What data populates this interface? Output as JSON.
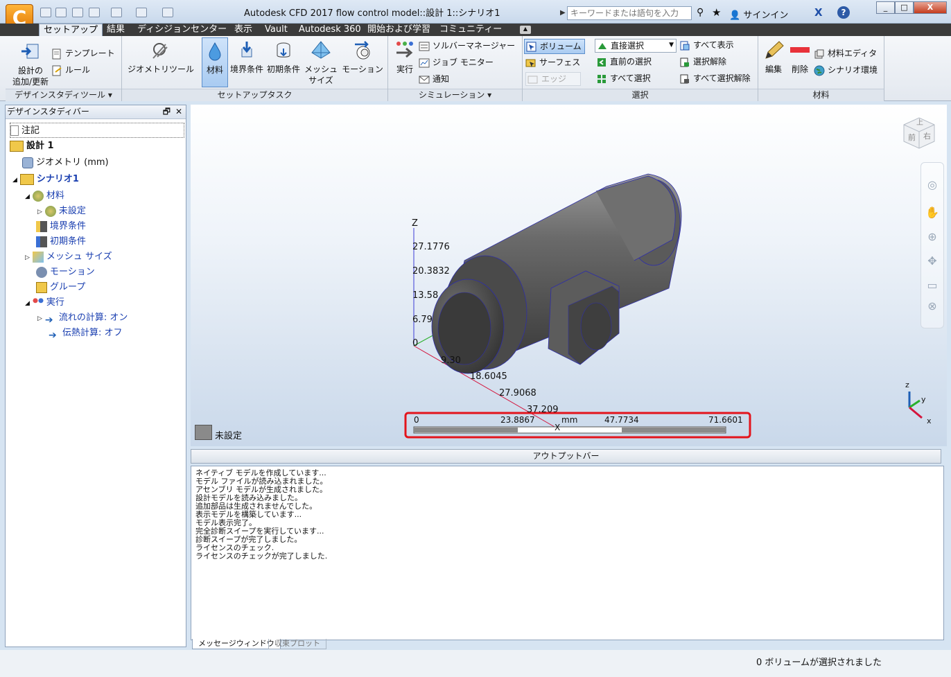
{
  "window": {
    "title": "Autodesk CFD 2017   flow control model::設計  1::シナリオ1",
    "search_placeholder": "キーワードまたは語句を入力",
    "signin": "サインイン",
    "minimize": "_",
    "maximize": "□",
    "close": "X"
  },
  "tabs": [
    "セットアップ",
    "結果",
    "ディシジョンセンター",
    "表示",
    "Vault",
    "Autodesk 360",
    "開始および学習",
    "コミュニティー"
  ],
  "ribbon": {
    "design_tools": {
      "group_label": "デザインスタディツール ▾",
      "add_update": [
        "設計の",
        "追加/更新"
      ],
      "template": "テンプレート",
      "rule": "ルール"
    },
    "setup": {
      "group_label": "セットアップタスク",
      "geometry_tool": "ジオメトリツール",
      "material": "材料",
      "boundary": "境界条件",
      "initial": "初期条件",
      "mesh": [
        "メッシュ",
        "サイズ"
      ],
      "motion": "モーション"
    },
    "simulation": {
      "group_label": "シミュレーション ▾",
      "run": "実行",
      "solver_manager": "ソルバーマネージャー",
      "job_monitor": "ジョブ モニター",
      "notify": "通知"
    },
    "select": {
      "group_label": "選択",
      "volume": "ボリューム",
      "surface": "サーフェス",
      "edge": "エッジ",
      "direct_select": "直接選択",
      "prev_select": "直前の選択",
      "select_all": "すべて選択",
      "show_all": "すべて表示",
      "deselect": "選択解除",
      "deselect_all": "すべて選択解除"
    },
    "material": {
      "group_label": "材料",
      "edit": "編集",
      "delete": "削除",
      "editor": "材料エディタ",
      "scenario_env": "シナリオ環境"
    }
  },
  "design_bar": {
    "title": "デザインスタディバー",
    "items": [
      {
        "label": "注記",
        "level": 0
      },
      {
        "label": "設計  1",
        "level": 0
      },
      {
        "label": "ジオメトリ (mm)",
        "level": 1
      },
      {
        "label": "シナリオ1",
        "level": 1
      },
      {
        "label": "材料",
        "level": 2
      },
      {
        "label": "未設定",
        "level": 3
      },
      {
        "label": "境界条件",
        "level": 2
      },
      {
        "label": "初期条件",
        "level": 2
      },
      {
        "label": "メッシュ サイズ",
        "level": 2
      },
      {
        "label": "モーション",
        "level": 2
      },
      {
        "label": "グループ",
        "level": 2
      },
      {
        "label": "実行",
        "level": 2
      },
      {
        "label": "流れの計算: オン",
        "level": 3
      },
      {
        "label": "伝熱計算: オフ",
        "level": 3
      }
    ]
  },
  "viewport": {
    "axis_z": "Z",
    "axis_x": "X",
    "z_ticks": [
      "27.1776",
      "20.3832",
      "13.58",
      "6.79",
      "0"
    ],
    "x_ticks": [
      "9.30",
      "18.6045",
      "27.9068",
      "37.209"
    ],
    "scale": {
      "labels": [
        "0",
        "23.8867",
        "47.7734",
        "71.6601"
      ],
      "unit": "mm"
    },
    "legend_label": "未設定",
    "viewcube": {
      "top": "上",
      "front": "前",
      "right": "右"
    },
    "triad": {
      "z": "z",
      "y": "y",
      "x": "x"
    }
  },
  "output": {
    "bar_title": "アウトプットバー",
    "lines": [
      "ネイティブ モデルを作成しています...",
      "モデル ファイルが読み込まれました。",
      "アセンブリ モデルが生成されました。",
      "設計モデルを読み込みました。",
      "追加部品は生成されませんでした。",
      "表示モデルを構築しています...",
      "モデル表示完了。",
      "完全診断スイープを実行しています...",
      "診断スイープが完了しました。",
      "ライセンスのチェック.",
      "ライセンスのチェックが完了しました."
    ],
    "tabs": [
      "メッセージウィンドウ",
      "収束プロット"
    ]
  },
  "status": {
    "text": "0 ボリュームが選択されました"
  },
  "colors": {
    "highlight_red": "#e3141c",
    "model_gray": "#5d5d5d",
    "axis_blue": "#3b3bd6",
    "axis_red": "#d4143c"
  }
}
